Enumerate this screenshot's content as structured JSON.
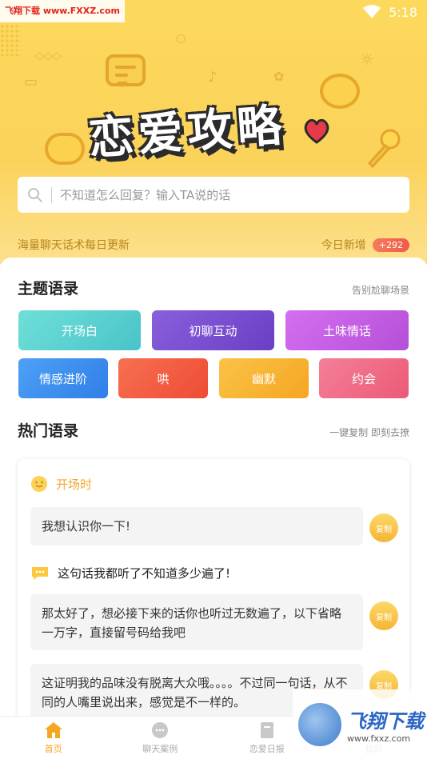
{
  "status_bar": {
    "site_watermark": "飞翔下载 www.FXXZ.com",
    "time": "5:18"
  },
  "banner": {
    "title": "恋爱攻略"
  },
  "search": {
    "placeholder": "不知道怎么回复？输入TA说的话"
  },
  "update_bar": {
    "left_text": "海量聊天话术每日更新",
    "today_label": "今日新增",
    "today_count": "+292"
  },
  "topics": {
    "title": "主题语录",
    "subtitle": "告别尬聊场景",
    "categories": [
      {
        "label": "开场白",
        "color": "#5ccfcf"
      },
      {
        "label": "初聊互动",
        "color": "#7b4fd0"
      },
      {
        "label": "土味情话",
        "color": "#c55fe0"
      },
      {
        "label": "情感进阶",
        "color": "#3f8ef0"
      },
      {
        "label": "哄",
        "color": "#f2593e"
      },
      {
        "label": "幽默",
        "color": "#f7b32f"
      },
      {
        "label": "约会",
        "color": "#f06a86"
      }
    ]
  },
  "popular": {
    "title": "热门语录",
    "subtitle": "一键复制 即刻去撩",
    "scene_label": "开场时",
    "messages": [
      {
        "text": "我想认识你一下!",
        "copy_label": "复制"
      },
      {
        "text": "那太好了，想必接下来的话你也听过无数遍了，以下省略一万字，直接留号码给我吧",
        "copy_label": "复制"
      },
      {
        "text": "这证明我的品味没有脱离大众哦。。。。不过同一句话，从不同的人嘴里说出来，感觉是不一样的。",
        "copy_label": "复制"
      }
    ],
    "question": "这句话我都听了不知道多少遍了!"
  },
  "bottom_nav": {
    "items": [
      {
        "label": "首页",
        "icon": "home-icon",
        "active": true
      },
      {
        "label": "聊天案例",
        "icon": "chat-case-icon",
        "active": false
      },
      {
        "label": "恋爱日报",
        "icon": "daily-icon",
        "active": false
      },
      {
        "label": "我的",
        "icon": "profile-icon",
        "active": false
      }
    ]
  },
  "corner_watermark": {
    "cn": "飞翔下载",
    "en": "www.fxxz.com"
  }
}
